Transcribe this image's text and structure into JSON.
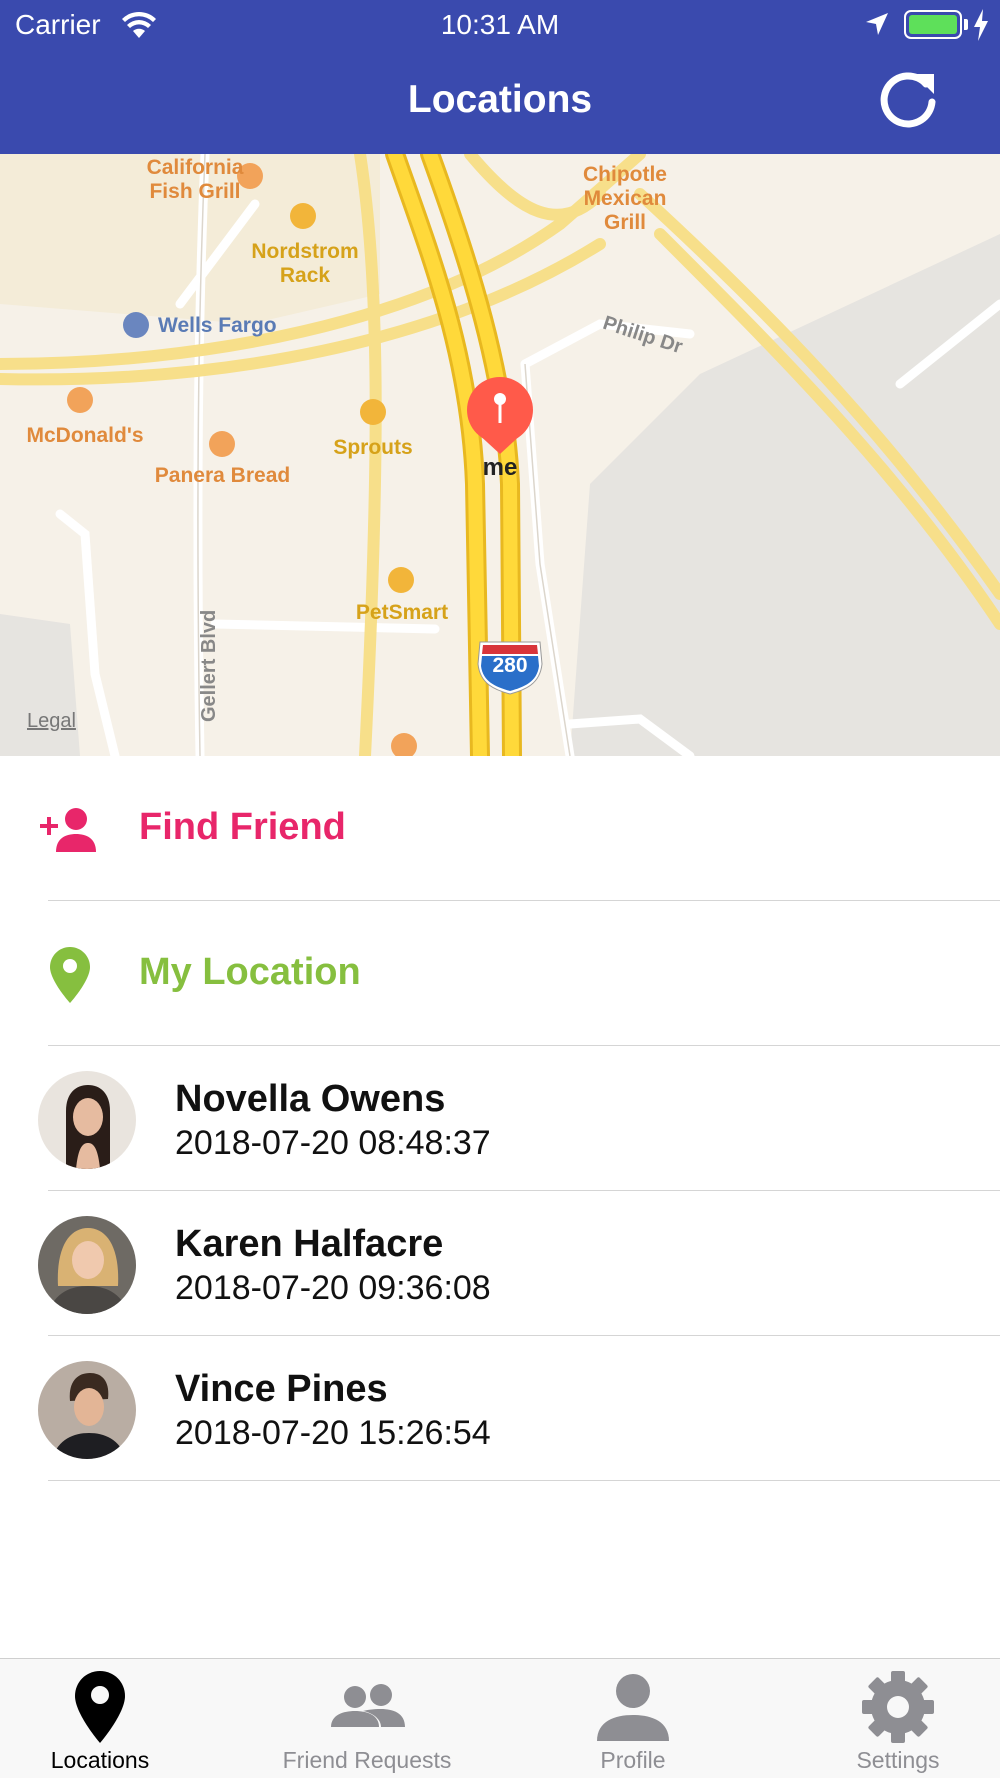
{
  "status_bar": {
    "carrier": "Carrier",
    "time": "10:31 AM",
    "battery_color": "#5ee05a"
  },
  "nav": {
    "title": "Locations",
    "refresh_icon": "refresh-icon",
    "background": "#3a4aae"
  },
  "map": {
    "pois": {
      "california_fish_grill": "California\nFish Grill",
      "nordstrom_rack": "Nordstrom\nRack",
      "chipotle": "Chipotle\nMexican\nGrill",
      "wells_fargo": "Wells Fargo",
      "mcdonalds": "McDonald's",
      "panera": "Panera Bread",
      "sprouts": "Sprouts",
      "petsmart": "PetSmart"
    },
    "roads": {
      "philip_dr": "Philip Dr",
      "gellert_blvd": "Gellert Blvd",
      "interstate": "280"
    },
    "me_label": "me",
    "legal": "Legal"
  },
  "actions": {
    "find_friend": {
      "label": "Find Friend",
      "color": "#e8266a",
      "icon": "add-person-icon"
    },
    "my_location": {
      "label": "My Location",
      "color": "#86bf3f",
      "icon": "location-pin-icon"
    }
  },
  "friends": [
    {
      "name": "Novella Owens",
      "time": "2018-07-20 08:48:37"
    },
    {
      "name": "Karen Halfacre",
      "time": "2018-07-20 09:36:08"
    },
    {
      "name": "Vince Pines",
      "time": "2018-07-20 15:26:54"
    }
  ],
  "tabs": [
    {
      "label": "Locations",
      "icon": "location-pin-icon",
      "active": true
    },
    {
      "label": "Friend Requests",
      "icon": "people-icon",
      "active": false
    },
    {
      "label": "Profile",
      "icon": "person-icon",
      "active": false
    },
    {
      "label": "Settings",
      "icon": "gear-icon",
      "active": false
    }
  ]
}
